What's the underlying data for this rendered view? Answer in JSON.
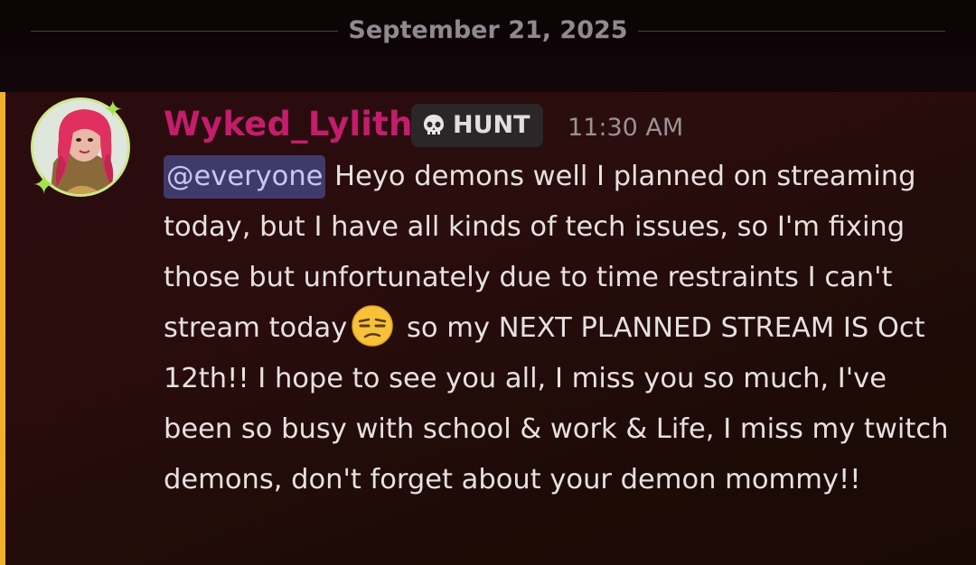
{
  "divider": {
    "date": "September 21, 2025"
  },
  "message": {
    "username": "Wyked_Lylith",
    "username_color": "#c31d6c",
    "badge": {
      "icon": "skull-icon",
      "label": "HUNT"
    },
    "timestamp": "11:30 AM",
    "mention": "@everyone",
    "mention_bar_color": "#f1b02c",
    "text_part1": " Heyo demons well I planned on streaming today, but I have all kinds of tech issues, so I'm  fixing those but unfortunately due to time restraints I can't  stream today",
    "emoji": "unamused-face-emoji",
    "text_part2": " so my NEXT PLANNED STREAM IS Oct 12th!! I hope to see you all, I miss you so much, I've been so busy with school & work & Life, I miss my twitch demons, don't forget about your  demon mommy!!"
  }
}
